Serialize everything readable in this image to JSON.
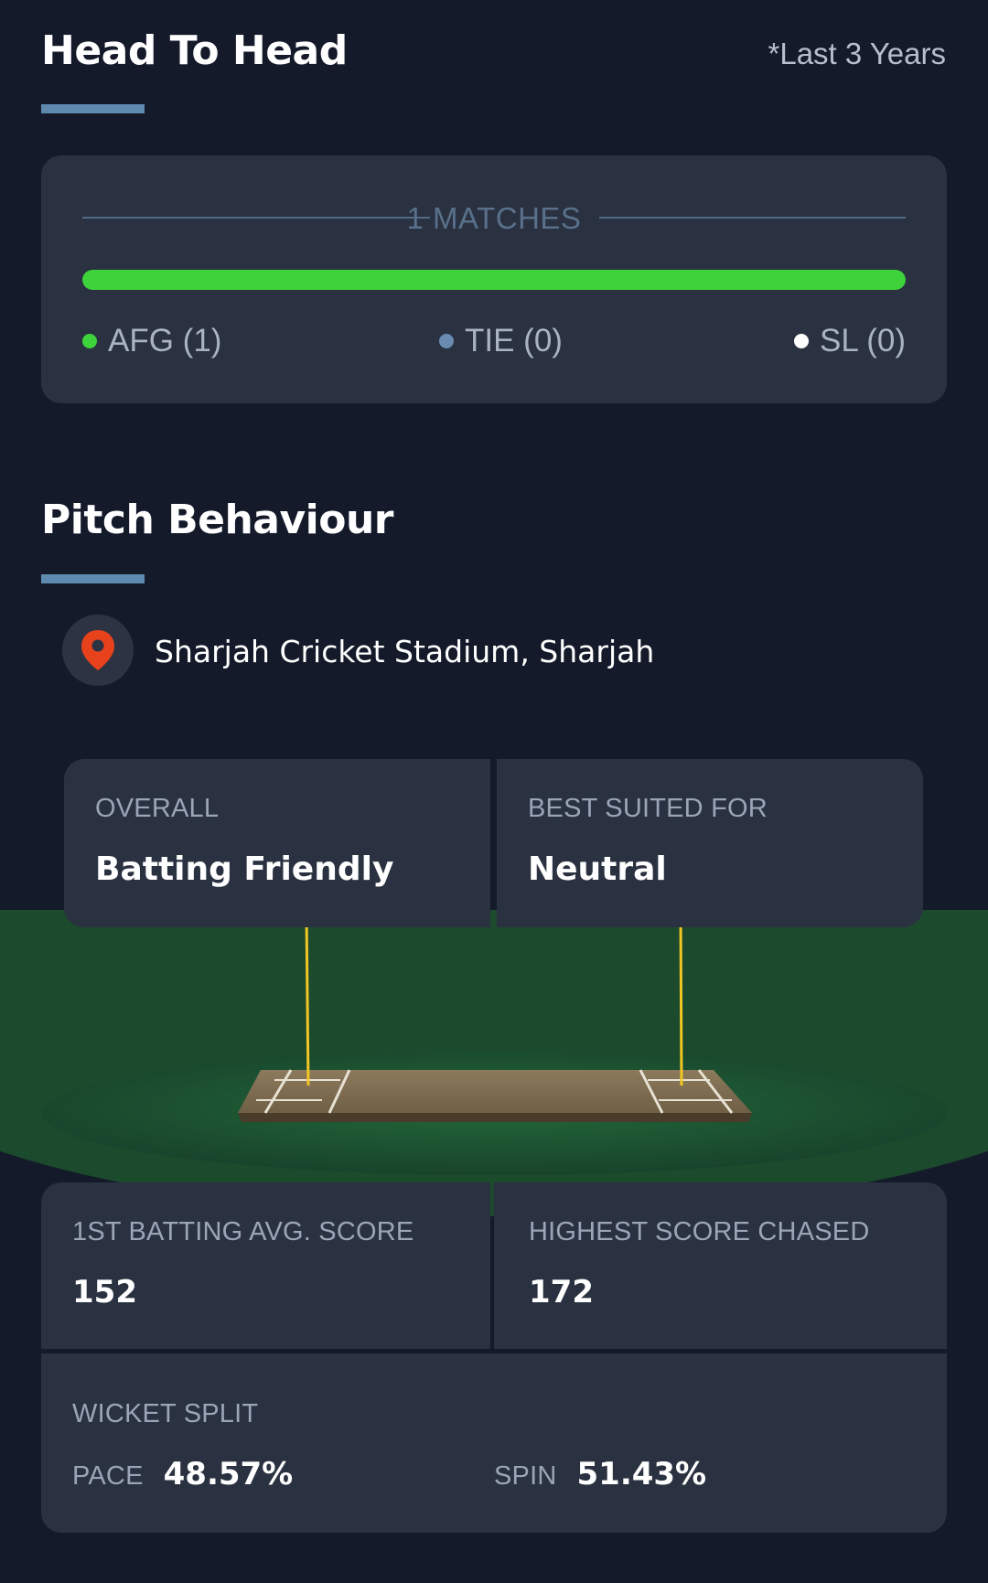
{
  "head_to_head": {
    "title": "Head To Head",
    "period_note": "*Last 3 Years",
    "matches_label": "1 MATCHES",
    "result_share": {
      "afg": 1,
      "tie": 0,
      "sl": 0
    },
    "legend": [
      {
        "label": "AFG (1)",
        "color": "#3ed33a"
      },
      {
        "label": "TIE (0)",
        "color": "#6a8bb0"
      },
      {
        "label": "SL (0)",
        "color": "#ffffff"
      }
    ]
  },
  "pitch": {
    "title": "Pitch Behaviour",
    "venue": "Sharjah Cricket Stadium, Sharjah",
    "venue_icon": "location-pin-icon",
    "overall_label": "OVERALL",
    "overall_value": "Batting Friendly",
    "best_suited_label": "BEST SUITED FOR",
    "best_suited_value": "Neutral"
  },
  "stats": {
    "first_batting_label": "1ST BATTING AVG. SCORE",
    "first_batting_value": "152",
    "highest_chased_label": "HIGHEST SCORE CHASED",
    "highest_chased_value": "172",
    "wicket_split_label": "WICKET SPLIT",
    "pace_label": "PACE",
    "pace_value": "48.57%",
    "spin_label": "SPIN",
    "spin_value": "51.43%"
  },
  "colors": {
    "background": "#141a2a",
    "card": "#2a3140",
    "accent_underline": "#5f8ab0",
    "win_green": "#3ed33a",
    "field_green": "#1f5a32",
    "pin_red": "#e8421c"
  }
}
